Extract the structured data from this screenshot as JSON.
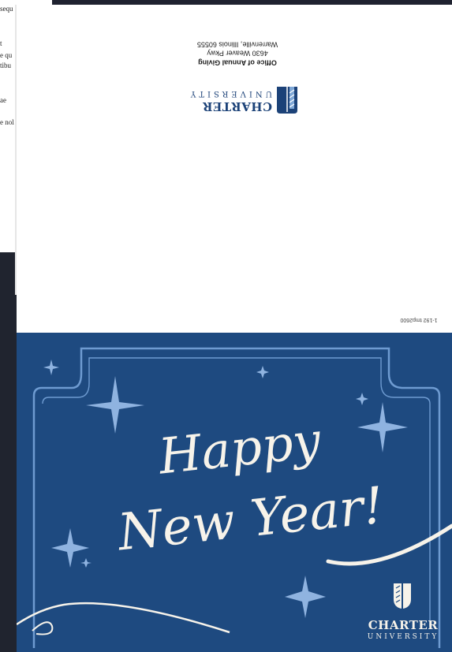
{
  "background_document": {
    "lines": [
      "sequ",
      "t",
      "e qu",
      "tibu",
      "ae",
      "e nol"
    ]
  },
  "card_back": {
    "logo": {
      "wordmark": "CHARTER",
      "subtitle": "UNIVERSITY"
    },
    "address": {
      "office": "Office of Annual Giving",
      "street": "4630 Weaver Pkwy",
      "city": "Warrenville, Illinois 60555"
    },
    "print_code": "1-192 tmp2600"
  },
  "card_front": {
    "greeting_line1": "Happy",
    "greeting_line2": "New Year!",
    "logo": {
      "wordmark": "CHARTER",
      "subtitle": "UNIVERSITY"
    }
  },
  "colors": {
    "navy": "#1e4a80",
    "frame": "#6e9bd1",
    "star": "#8fb3e0",
    "cream": "#f7f3ea"
  }
}
